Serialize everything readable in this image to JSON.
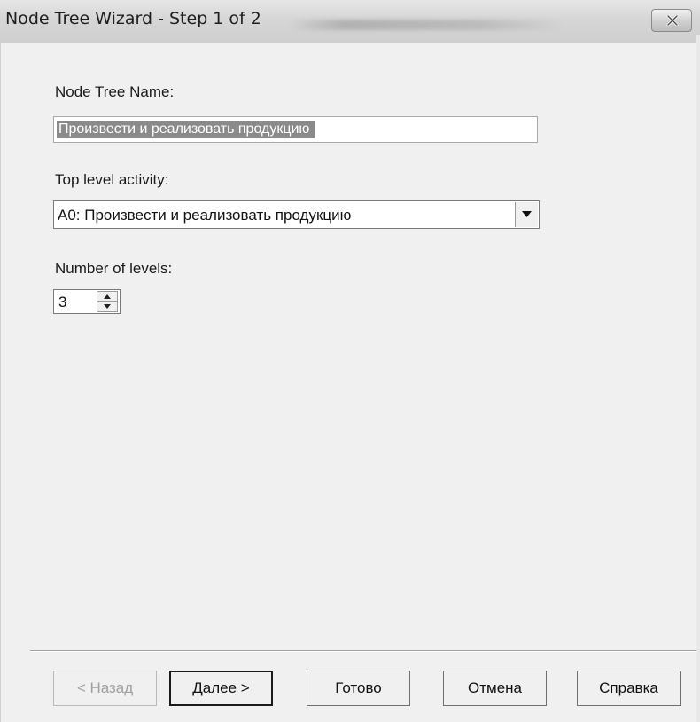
{
  "window": {
    "title": "Node Tree Wizard - Step 1 of 2"
  },
  "form": {
    "name_label": "Node Tree Name:",
    "name_value": "Произвести и  реализовать продукцию",
    "activity_label": "Top level activity:",
    "activity_value": "A0:  Произвести и  реализовать продукцию",
    "levels_label": "Number of levels:",
    "levels_value": "3"
  },
  "buttons": {
    "back": "< Назад",
    "next": "Далее >",
    "finish": "Готово",
    "cancel": "Отмена",
    "help": "Справка"
  },
  "icons": {
    "close": "close-icon",
    "dropdown": "chevron-down-icon",
    "spin_up": "triangle-up-icon",
    "spin_down": "triangle-down-icon"
  },
  "colors": {
    "selection": "#8a8a8a",
    "dialog_bg": "#f0f0f0"
  }
}
